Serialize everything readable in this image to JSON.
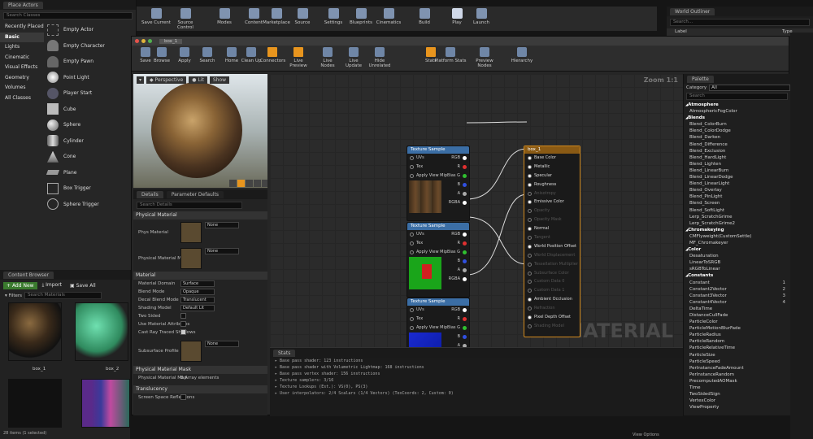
{
  "place_actors": {
    "tab": "Place Actors",
    "search_placeholder": "Search Classes",
    "categories": [
      "Recently Placed",
      "Basic",
      "Lights",
      "Cinematic",
      "Visual Effects",
      "Geometry",
      "Volumes",
      "All Classes"
    ],
    "selected": "Basic",
    "items": [
      "Empty Actor",
      "Empty Character",
      "Empty Pawn",
      "Point Light",
      "Player Start",
      "Cube",
      "Sphere",
      "Cylinder",
      "Cone",
      "Plane",
      "Box Trigger",
      "Sphere Trigger"
    ]
  },
  "main_toolbar": [
    "Save Current",
    "Source Control",
    "Modes",
    "Content",
    "Marketplace",
    "Source",
    "Settings",
    "Blueprints",
    "Cinematics",
    "Build",
    "Play",
    "Launch"
  ],
  "world_outliner": {
    "title": "World Outliner",
    "search": "Search...",
    "col_label": "Label",
    "col_type": "Type"
  },
  "content_browser": {
    "tab": "Content Browser",
    "add_new": "Add New",
    "import": "Import",
    "save_all": "Save All",
    "filters": "Filters",
    "search_placeholder": "Search Materials",
    "assets": [
      "box_1",
      "box_2"
    ],
    "status": "28 items (1 selected)",
    "view_options": "View Options"
  },
  "material_editor": {
    "toolbar": [
      "Save",
      "Browse",
      "Apply",
      "Search",
      "Home",
      "Clean Up",
      "Connectors",
      "Live Preview",
      "Live Nodes",
      "Live Update",
      "Hide Unrelated",
      "Stats",
      "Platform Stats",
      "Preview Nodes",
      "Hierarchy"
    ],
    "viewport": {
      "perspective": "Perspective",
      "lit": "Lit",
      "show": "Show"
    },
    "details": {
      "tab": "Details",
      "tab2": "Parameter Defaults",
      "search_placeholder": "Search Details",
      "sections": {
        "phys": "Physical Material",
        "material": "Material",
        "mask": "Physical Material Mask",
        "translucency": "Translucency"
      },
      "rows": {
        "phys_material": "Phys Material",
        "phys_mask": "Physical Material Mask",
        "none": "None",
        "domain": "Material Domain",
        "domain_v": "Surface",
        "blend": "Blend Mode",
        "blend_v": "Opaque",
        "decal": "Decal Blend Mode",
        "decal_v": "Translucent",
        "shading": "Shading Model",
        "shading_v": "Default Lit",
        "two_sided": "Two Sided",
        "use_attr": "Use Material Attributes",
        "cast_ray": "Cast Ray Traced Shadows",
        "subsurface": "Subsurface Profile",
        "mask_map": "Physical Material Map",
        "mask_map_v": "8 Array elements",
        "ssr": "Screen Space Reflections"
      }
    },
    "graph": {
      "zoom": "Zoom 1:1",
      "watermark": "MATERIAL",
      "tex_nodes": [
        {
          "title": "Texture Sample"
        },
        {
          "title": "Texture Sample"
        },
        {
          "title": "Texture Sample"
        }
      ],
      "tex_pins_in": [
        "UVs",
        "Tex",
        "Apply View MipBias"
      ],
      "tex_pins_out": [
        "RGB",
        "R",
        "G",
        "B",
        "A",
        "RGBA"
      ],
      "result_title": "box_1",
      "result_pins": [
        "Base Color",
        "Metallic",
        "Specular",
        "Roughness",
        "Anisotropy",
        "Emissive Color",
        "Opacity",
        "Opacity Mask",
        "Normal",
        "Tangent",
        "World Position Offset",
        "World Displacement",
        "Tessellation Multiplier",
        "Subsurface Color",
        "Custom Data 0",
        "Custom Data 1",
        "Ambient Occlusion",
        "Refraction",
        "Pixel Depth Offset",
        "Shading Model"
      ]
    },
    "stats": {
      "tab": "Stats",
      "lines": [
        "Base pass shader: 123 instructions",
        "Base pass shader with Volumetric Lightmap: 168 instructions",
        "Base pass vertex shader: 156 instructions",
        "Texture samplers: 3/16",
        "Texture Lookups (Est.): VS(0), PS(3)",
        "User interpolators: 2/4 Scalars (1/4 Vectors) (TexCoords: 2, Custom: 0)"
      ]
    },
    "palette": {
      "tab": "Palette",
      "category_label": "Category",
      "category_value": "All",
      "search_placeholder": "Search",
      "items": [
        {
          "t": "cat",
          "n": "Atmosphere"
        },
        {
          "t": "i",
          "n": "AtmosphericFogColor"
        },
        {
          "t": "cat",
          "n": "Blends"
        },
        {
          "t": "i",
          "n": "Blend_ColorBurn"
        },
        {
          "t": "i",
          "n": "Blend_ColorDodge"
        },
        {
          "t": "i",
          "n": "Blend_Darken"
        },
        {
          "t": "i",
          "n": "Blend_Difference"
        },
        {
          "t": "i",
          "n": "Blend_Exclusion"
        },
        {
          "t": "i",
          "n": "Blend_HardLight"
        },
        {
          "t": "i",
          "n": "Blend_Lighten"
        },
        {
          "t": "i",
          "n": "Blend_LinearBurn"
        },
        {
          "t": "i",
          "n": "Blend_LinearDodge"
        },
        {
          "t": "i",
          "n": "Blend_LinearLight"
        },
        {
          "t": "i",
          "n": "Blend_Overlay"
        },
        {
          "t": "i",
          "n": "Blend_PinLight"
        },
        {
          "t": "i",
          "n": "Blend_Screen"
        },
        {
          "t": "i",
          "n": "Blend_SoftLight"
        },
        {
          "t": "i",
          "n": "Lerp_ScratchGrime"
        },
        {
          "t": "i",
          "n": "Lerp_ScratchGrime2"
        },
        {
          "t": "cat",
          "n": "Chromakeying"
        },
        {
          "t": "i",
          "n": "CMFlyweight(CustomSettle)"
        },
        {
          "t": "i",
          "n": "MF_Chromakeyer"
        },
        {
          "t": "cat",
          "n": "Color"
        },
        {
          "t": "i",
          "n": "Desaturation"
        },
        {
          "t": "i",
          "n": "LinearToSRGB"
        },
        {
          "t": "i",
          "n": "sRGBToLinear"
        },
        {
          "t": "cat",
          "n": "Constants"
        },
        {
          "t": "i",
          "n": "Constant",
          "k": "1"
        },
        {
          "t": "i",
          "n": "Constant2Vector",
          "k": "2"
        },
        {
          "t": "i",
          "n": "Constant3Vector",
          "k": "3"
        },
        {
          "t": "i",
          "n": "Constant4Vector",
          "k": "4"
        },
        {
          "t": "i",
          "n": "DeltaTime"
        },
        {
          "t": "i",
          "n": "DistanceCullFade"
        },
        {
          "t": "i",
          "n": "ParticleColor"
        },
        {
          "t": "i",
          "n": "ParticleMotionBlurFade"
        },
        {
          "t": "i",
          "n": "ParticleRadius"
        },
        {
          "t": "i",
          "n": "ParticleRandom"
        },
        {
          "t": "i",
          "n": "ParticleRelativeTime"
        },
        {
          "t": "i",
          "n": "ParticleSize"
        },
        {
          "t": "i",
          "n": "ParticleSpeed"
        },
        {
          "t": "i",
          "n": "PerInstanceFadeAmount"
        },
        {
          "t": "i",
          "n": "PerInstanceRandom"
        },
        {
          "t": "i",
          "n": "PrecomputedAOMask"
        },
        {
          "t": "i",
          "n": "Time"
        },
        {
          "t": "i",
          "n": "TwoSidedSign"
        },
        {
          "t": "i",
          "n": "VertexColor"
        },
        {
          "t": "i",
          "n": "ViewProperty"
        }
      ]
    }
  }
}
